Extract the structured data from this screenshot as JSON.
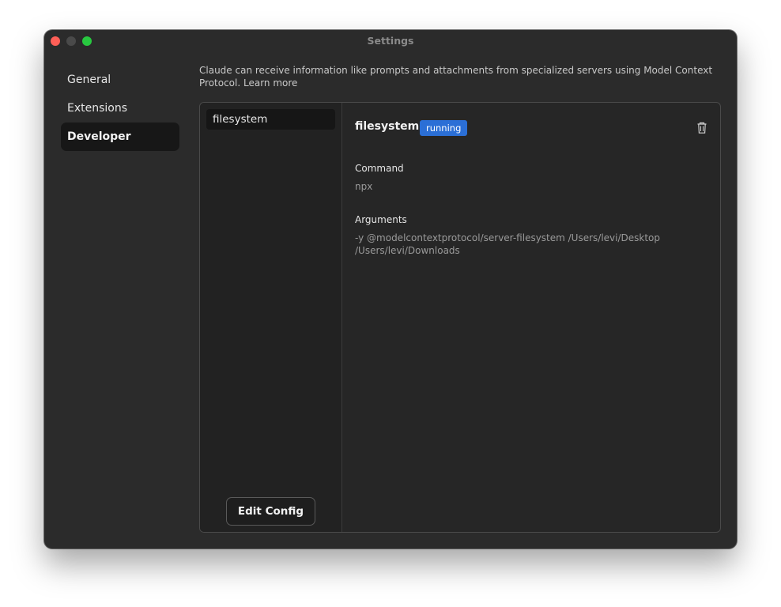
{
  "window": {
    "title": "Settings"
  },
  "sidebar": {
    "items": [
      {
        "label": "General",
        "active": false
      },
      {
        "label": "Extensions",
        "active": false
      },
      {
        "label": "Developer",
        "active": true
      }
    ]
  },
  "intro": {
    "text": "Claude can receive information like prompts and attachments from specialized servers using Model Context Protocol.",
    "link_label": "Learn more"
  },
  "servers": {
    "items": [
      {
        "name": "filesystem"
      }
    ],
    "edit_config_label": "Edit Config"
  },
  "detail": {
    "name": "filesystem",
    "status": "running",
    "command_label": "Command",
    "command_value": "npx",
    "arguments_label": "Arguments",
    "arguments_value": "-y @modelcontextprotocol/server-filesystem /Users/levi/Desktop /Users/levi/Downloads",
    "delete_icon": "trash-icon"
  },
  "colors": {
    "status_running": "#2b6fd6",
    "window_bg": "#2b2b2b"
  }
}
